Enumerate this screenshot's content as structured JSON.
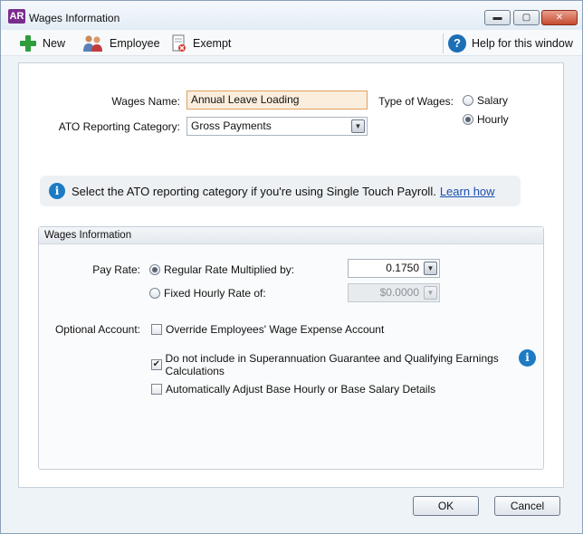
{
  "window": {
    "app_logo": "AR",
    "title": "Wages Information",
    "controls": {
      "minimize": "▬",
      "maximize": "▢",
      "close": "✕"
    }
  },
  "toolbar": {
    "new_label": "New",
    "employee_label": "Employee",
    "exempt_label": "Exempt",
    "help_label": "Help for this window",
    "help_glyph": "?"
  },
  "form": {
    "wages_name_label": "Wages Name:",
    "wages_name_value": "Annual Leave Loading",
    "ato_label": "ATO Reporting Category:",
    "ato_value": "Gross Payments",
    "type_label": "Type of Wages:",
    "type_options": [
      {
        "label": "Salary",
        "selected": false
      },
      {
        "label": "Hourly",
        "selected": true
      }
    ]
  },
  "banner": {
    "info_glyph": "i",
    "message": "Select the ATO reporting category if you're using Single Touch Payroll.",
    "link": "Learn how"
  },
  "wages_group": {
    "title": "Wages Information",
    "pay_rate_label": "Pay Rate:",
    "regular_rate_label": "Regular Rate Multiplied by:",
    "regular_rate_value": "0.1750",
    "fixed_rate_label": "Fixed Hourly Rate of:",
    "fixed_rate_value": "$0.0000",
    "optional_account_label": "Optional Account:",
    "override_label": "Override Employees' Wage Expense Account",
    "super_label": "Do not include in Superannuation Guarantee and Qualifying Earnings Calculations",
    "auto_adjust_label": "Automatically Adjust Base Hourly or Base Salary Details",
    "info_glyph": "i",
    "check_mark": "✔"
  },
  "buttons": {
    "ok": "OK",
    "cancel": "Cancel"
  },
  "dropdown_glyph": "▼"
}
